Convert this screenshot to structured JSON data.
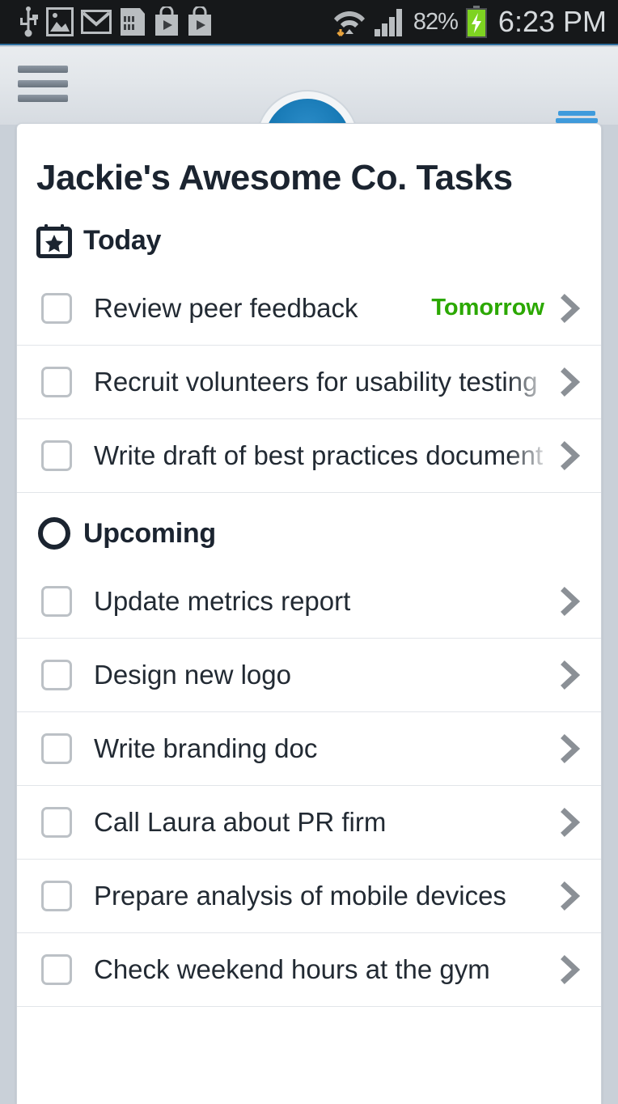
{
  "statusbar": {
    "left_icons": [
      "usb-icon",
      "gallery-image-icon",
      "gmail-icon",
      "sd-card-icon",
      "play-store-icon",
      "play-store-icon"
    ],
    "right_icons": [
      "wifi-download-icon",
      "cellular-signal-icon"
    ],
    "battery_percent": "82%",
    "battery_icon": "battery-charging-icon",
    "clock": "6:23 PM",
    "battery_color": "#7ed321",
    "accent_color": "#2f6f9e"
  },
  "actionbar": {
    "menu_label": "menu-button",
    "add_task_label": "add-task-button",
    "archive_label": "archive-button",
    "add_button_color": "#1678b4",
    "archive_icon_color": "#2f8fd6"
  },
  "page": {
    "title": "Jackie's Awesome Co. Tasks"
  },
  "sections": [
    {
      "id": "today",
      "label": "Today",
      "icon": "calendar-star-icon",
      "tasks": [
        {
          "title": "Review peer feedback",
          "due": "Tomorrow",
          "checked": false
        },
        {
          "title": "Recruit volunteers for usability testing",
          "due": "",
          "checked": false
        },
        {
          "title": "Write draft of best practices document",
          "due": "",
          "checked": false
        }
      ]
    },
    {
      "id": "upcoming",
      "label": "Upcoming",
      "icon": "circle-outline-icon",
      "tasks": [
        {
          "title": "Update metrics report",
          "due": "",
          "checked": false
        },
        {
          "title": "Design new logo",
          "due": "",
          "checked": false
        },
        {
          "title": "Write branding doc",
          "due": "",
          "checked": false
        },
        {
          "title": "Call Laura about PR firm",
          "due": "",
          "checked": false
        },
        {
          "title": "Prepare analysis of mobile devices",
          "due": "",
          "checked": false
        },
        {
          "title": "Check weekend hours at the gym",
          "due": "",
          "checked": false
        }
      ]
    }
  ],
  "colors": {
    "due_green": "#2ba800",
    "text_dark": "#1b2430",
    "chevron_gray": "#8b9096",
    "card_bg": "#ffffff",
    "page_bg": "#c9d0d8"
  }
}
